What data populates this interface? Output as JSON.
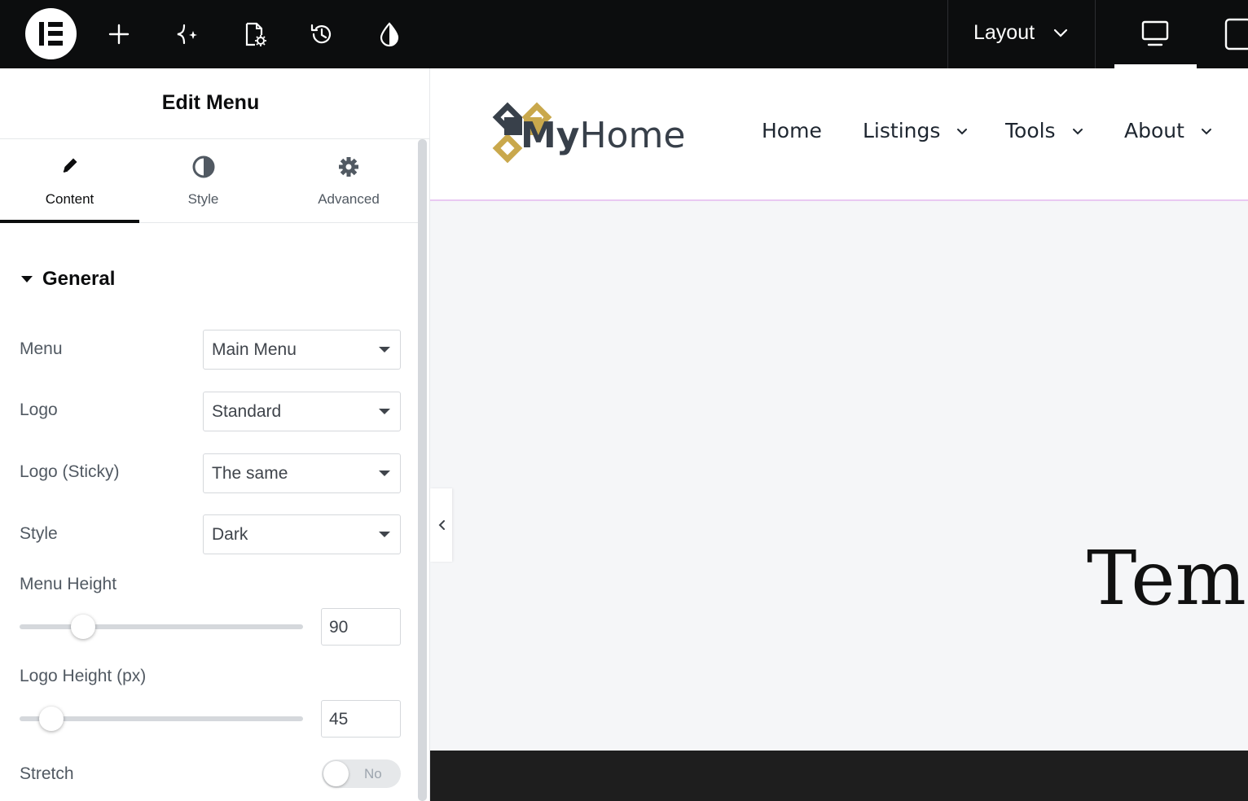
{
  "topbar": {
    "icons": [
      "elementor-logo-icon",
      "plus-icon",
      "ai-sparkle-icon",
      "page-settings-icon",
      "history-icon",
      "theme-style-icon"
    ],
    "layout_label": "Layout",
    "colors": {
      "background": "#0c0d0e",
      "foreground": "#ffffff"
    }
  },
  "panel": {
    "title": "Edit Menu",
    "tabs": [
      {
        "label": "Content",
        "icon": "pencil-icon",
        "active": true
      },
      {
        "label": "Style",
        "icon": "half-circle-icon",
        "active": false
      },
      {
        "label": "Advanced",
        "icon": "gear-icon",
        "active": false
      }
    ],
    "section_title": "General",
    "controls": {
      "menu": {
        "label": "Menu",
        "value": "Main Menu"
      },
      "logo": {
        "label": "Logo",
        "value": "Standard"
      },
      "logo_sticky": {
        "label": "Logo (Sticky)",
        "value": "The same"
      },
      "style": {
        "label": "Style",
        "value": "Dark"
      },
      "menu_height": {
        "label": "Menu Height",
        "value": "90",
        "slider_fraction": 0.22
      },
      "logo_height": {
        "label": "Logo Height (px)",
        "value": "45",
        "slider_fraction": 0.11
      },
      "stretch": {
        "label": "Stretch",
        "toggle_label": "No",
        "on": false
      }
    }
  },
  "preview": {
    "brand": {
      "my": "My",
      "home": "Home",
      "colors": {
        "dark": "#38404a",
        "gold": "#c9a84c"
      }
    },
    "nav": [
      {
        "label": "Home",
        "has_dropdown": false
      },
      {
        "label": "Listings",
        "has_dropdown": true
      },
      {
        "label": "Tools",
        "has_dropdown": true
      },
      {
        "label": "About",
        "has_dropdown": true
      }
    ],
    "hero_title": "Temp",
    "colors": {
      "header_border": "#e9c9f2",
      "footer": "#1e1e1e",
      "canvas": "#f5f6f8"
    }
  }
}
